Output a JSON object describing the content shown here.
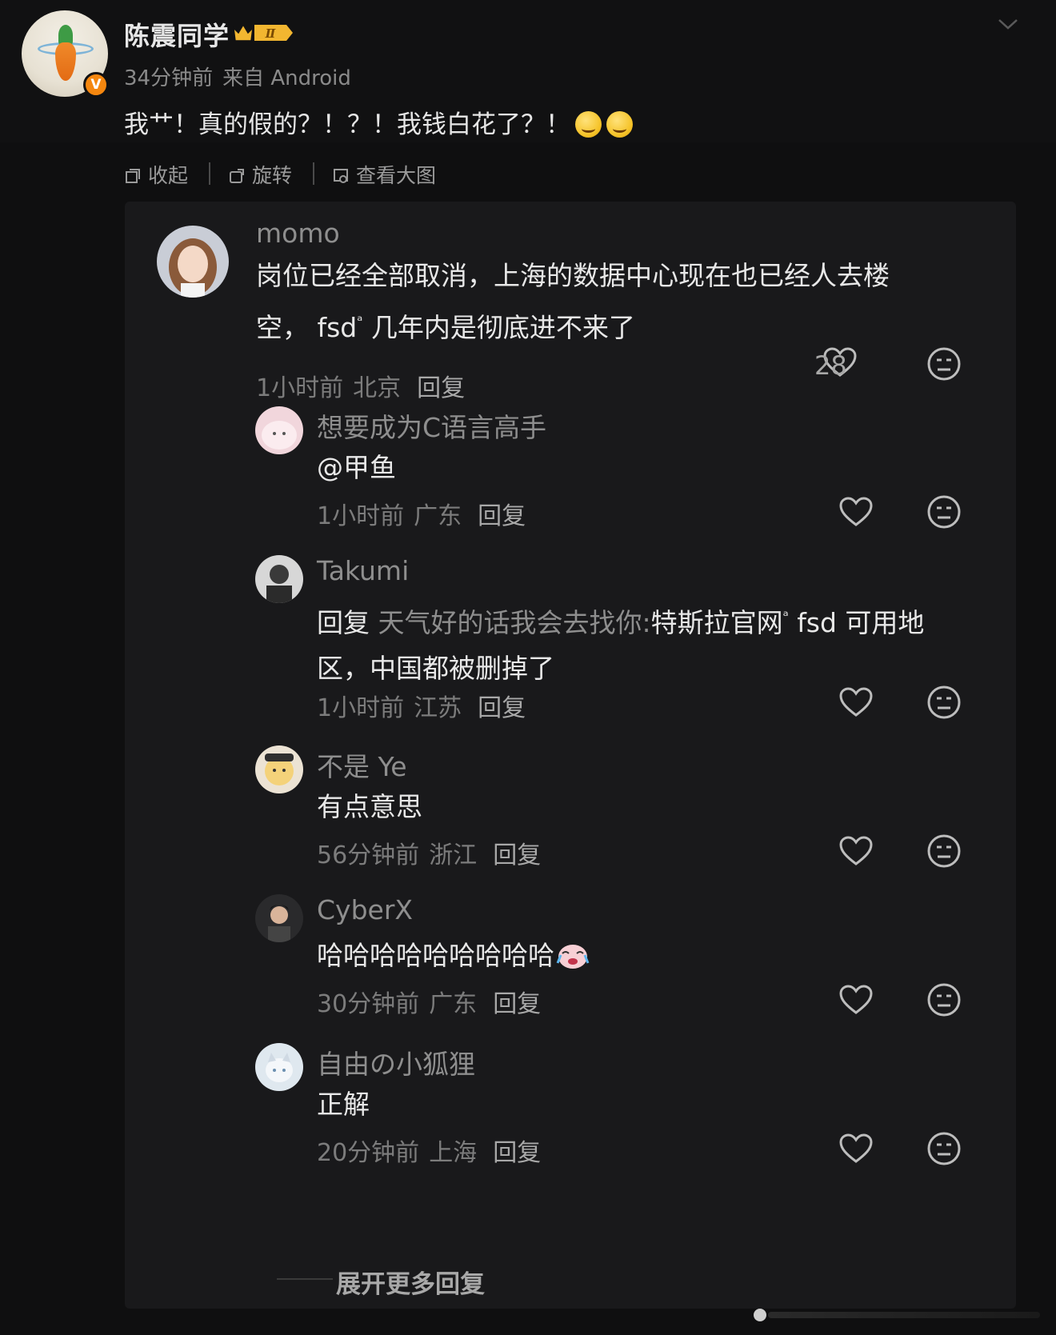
{
  "post": {
    "author": "陈震同学",
    "level_badge": "Ⅱ",
    "time": "34分钟前",
    "source": "来自 Android",
    "text": "我艹！真的假的？！？！我钱白花了？！"
  },
  "toolbar": {
    "collapse": "收起",
    "rotate": "旋转",
    "view_large": "查看大图"
  },
  "comment": {
    "username": "momo",
    "text_line1": "岗位已经全部取消，上海的数据中心现在也已经人去楼",
    "text_line2_a": "空，",
    "text_line2_link": "fsd",
    "text_line2_b": "几年内是彻底进不来了",
    "time": "1小时前",
    "region": "北京",
    "reply_label": "回复",
    "likes": "28"
  },
  "replies": [
    {
      "username": "想要成为C语言高手",
      "text": "@甲鱼",
      "time": "1小时前",
      "region": "广东",
      "reply_label": "回复"
    },
    {
      "username": "Takumi",
      "reply_prefix": "回复",
      "reply_to": "天气好的话我会去找你:",
      "link1": "特斯拉官网",
      "text_after": "fsd 可用地",
      "text_line2": "区，中国都被删掉了",
      "time": "1小时前",
      "region": "江苏",
      "reply_label": "回复"
    },
    {
      "username": "不是 Ye",
      "text": "有点意思",
      "time": "56分钟前",
      "region": "浙江",
      "reply_label": "回复"
    },
    {
      "username": "CyberX",
      "text": "哈哈哈哈哈哈哈哈哈",
      "time": "30分钟前",
      "region": "广东",
      "reply_label": "回复"
    },
    {
      "username": "自由の小狐狸",
      "text": "正解",
      "time": "20分钟前",
      "region": "上海",
      "reply_label": "回复"
    }
  ],
  "more_replies": "展开更多回复",
  "colors": {
    "background": "#0f0f10",
    "card": "#19191b",
    "verified": "#f5870f",
    "level_badge": "#f2b630"
  },
  "icons": {
    "toolbar": [
      "collapse-icon",
      "rotate-icon",
      "view-large-icon"
    ],
    "actions": [
      "heart-icon",
      "dislike-face-icon"
    ],
    "header": "chevron-down-icon"
  }
}
